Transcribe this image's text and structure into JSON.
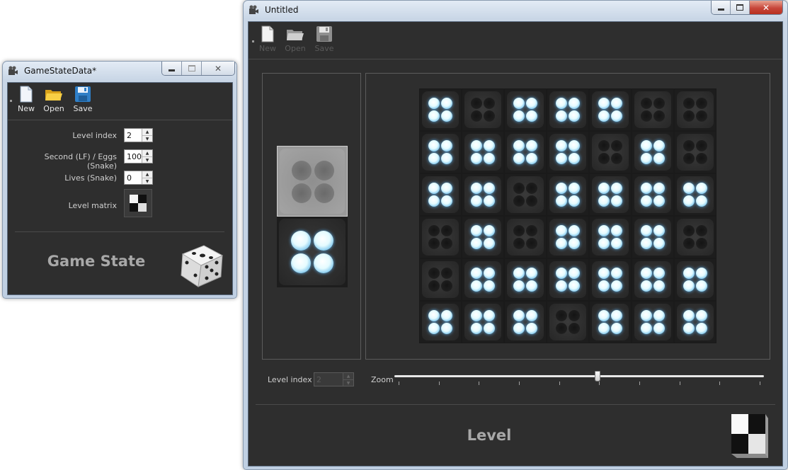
{
  "game_state_window": {
    "title": "GameStateData*",
    "toolbar": {
      "new_label": "New",
      "open_label": "Open",
      "save_label": "Save"
    },
    "fields": {
      "level_index_label": "Level index",
      "level_index_value": "2",
      "second_eggs_label": "Second (LF) / Eggs (Snake)",
      "second_eggs_value": "100",
      "lives_label": "Lives (Snake)",
      "lives_value": "0",
      "level_matrix_label": "Level matrix"
    },
    "panel_title": "Game State",
    "icons": {
      "app": "film-reel-icon",
      "new": "new-file-icon",
      "open": "folder-open-icon",
      "save": "floppy-disk-icon",
      "matrix": "checker-cube-icon",
      "dice": "dice-icon"
    }
  },
  "level_window": {
    "title": "Untitled",
    "toolbar": {
      "new_label": "New",
      "open_label": "Open",
      "save_label": "Save"
    },
    "palette": [
      "off",
      "on"
    ],
    "grid": [
      [
        1,
        0,
        1,
        1,
        1,
        0,
        0
      ],
      [
        1,
        1,
        1,
        1,
        0,
        1,
        0
      ],
      [
        1,
        1,
        0,
        1,
        1,
        1,
        1
      ],
      [
        0,
        1,
        0,
        1,
        1,
        1,
        0
      ],
      [
        0,
        1,
        1,
        1,
        1,
        1,
        1
      ],
      [
        1,
        1,
        1,
        0,
        1,
        1,
        1
      ]
    ],
    "level_index_label": "Level index",
    "level_index_value": "2",
    "zoom_label": "Zoom",
    "zoom_value": 0.55,
    "panel_title": "Level"
  },
  "colors": {
    "panel_bg": "#2e2e2e",
    "glow": "#aee8ff",
    "title_text": "#a8a8a8"
  }
}
